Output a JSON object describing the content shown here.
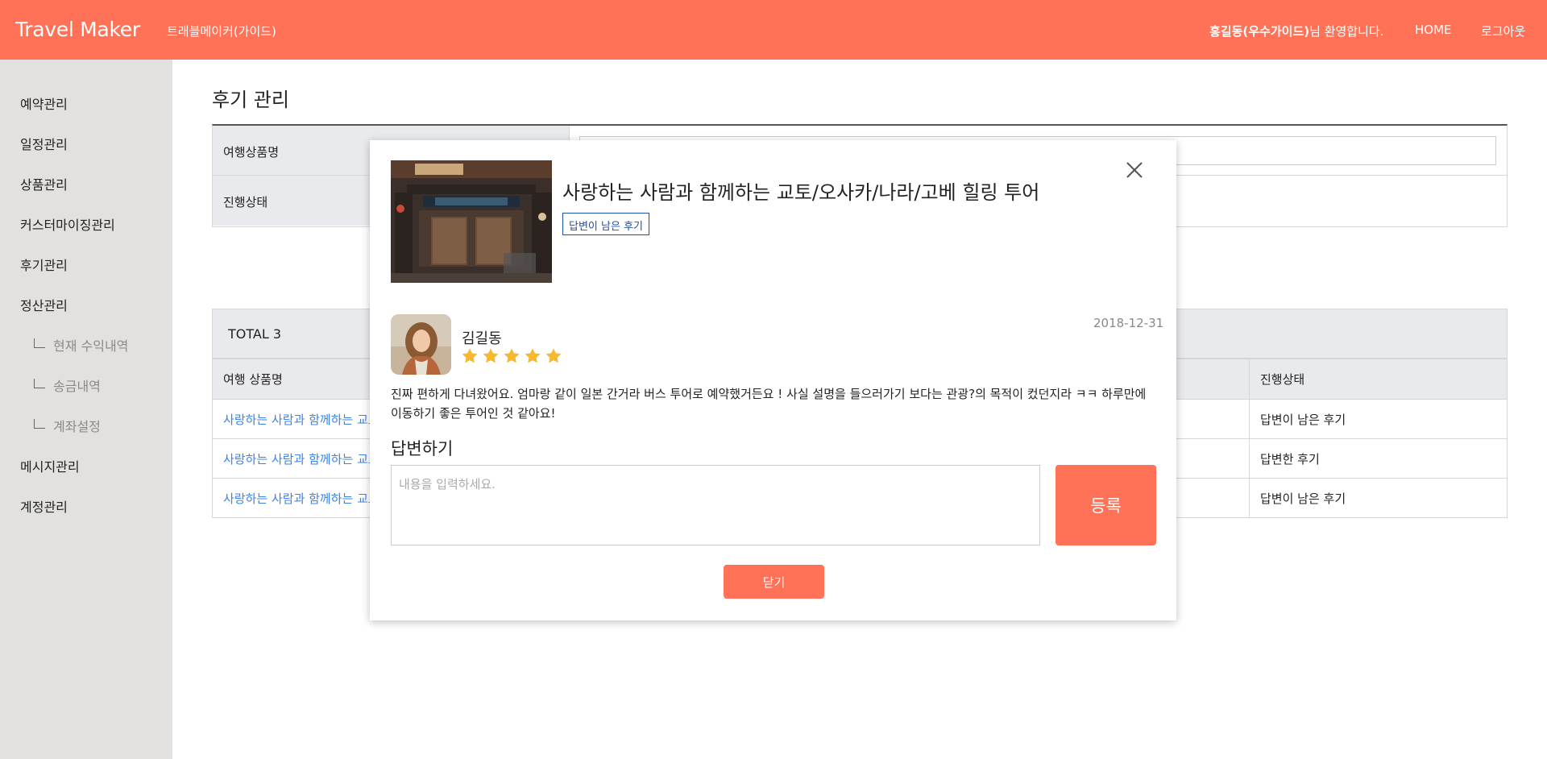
{
  "header": {
    "brand": "Travel Maker",
    "subtitle": "트래블메이커(가이드)",
    "welcome_name": "홍길동(우수가이드)",
    "welcome_suffix": "님 환영합니다.",
    "home": "HOME",
    "logout": "로그아웃"
  },
  "sidebar": {
    "items": [
      "예약관리",
      "일정관리",
      "상품관리",
      "커스터마이징관리",
      "후기관리",
      "정산관리"
    ],
    "sub_items": [
      "현재 수익내역",
      "송금내역",
      "계좌설정"
    ],
    "items_after": [
      "메시지관리",
      "계정관리"
    ]
  },
  "main": {
    "title": "후기 관리",
    "filter": {
      "product_label": "여행상품명",
      "status_label": "진행상태"
    },
    "total": "TOTAL 3",
    "table": {
      "headers": [
        "여행 상품명",
        "진행상태"
      ],
      "rows": [
        {
          "product": "사랑하는 사람과 함께하는 교토/오사카/나라/고베 힐링 투어",
          "status": "답변이 남은 후기"
        },
        {
          "product": "사랑하는 사람과 함께하는 교토/오사카/나라/고베 힐링 투어",
          "status": "답변한 후기"
        },
        {
          "product": "사랑하는 사람과 함께하는 교토/오사카/나라/고베 힐링 투어",
          "status": "답변이 남은 후기"
        }
      ]
    }
  },
  "modal": {
    "tour_title": "사랑하는 사람과 함께하는 교토/오사카/나라/고베 힐링 투어",
    "badge": "답변이 남은 후기",
    "reviewer": "김길동",
    "rating": 5,
    "date": "2018-12-31",
    "review_text": "진짜 편하게 다녀왔어요. 엄마랑 같이 일본 간거라 버스 투어로 예약했거든요 ! 사실 설명을 들으러가기 보다는 관광?의 목적이 컸던지라 ㅋㅋ 하루만에 이동하기 좋은 투어인 것 같아요!",
    "reply_heading": "답변하기",
    "reply_placeholder": "내용을 입력하세요.",
    "submit_label": "등록",
    "close_label": "닫기"
  },
  "colors": {
    "accent": "#ff7257",
    "sidebar_bg": "#e2e1df",
    "link": "#3b83e6",
    "badge": "#1e4fa8",
    "star": "#f5b82e"
  }
}
